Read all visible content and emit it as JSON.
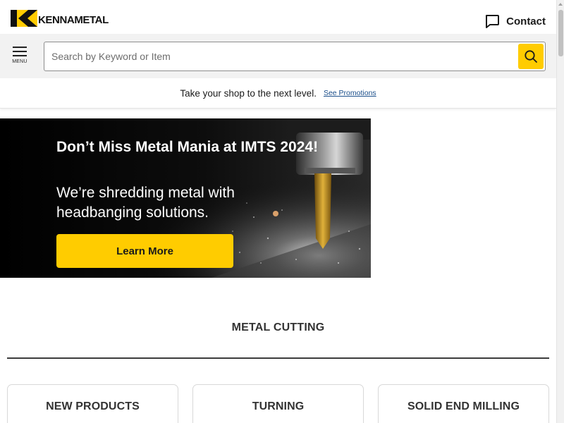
{
  "header": {
    "logo_text": "KENNAMETAL",
    "contact_label": "Contact"
  },
  "icons": {
    "logo": "kennametal-k-logo-icon",
    "contact": "chat-bubble-icon",
    "menu": "hamburger-menu-icon",
    "search": "search-icon"
  },
  "search": {
    "menu_label": "MENU",
    "placeholder": "Search by Keyword or Item",
    "value": ""
  },
  "promo": {
    "text": "Take your shop to the next level.",
    "link": "See Promotions"
  },
  "hero": {
    "title": "Don’t Miss Metal Mania at IMTS 2024!",
    "subtitle": "We’re shredding metal with headbanging solutions.",
    "button": "Learn More"
  },
  "section": {
    "title": "METAL CUTTING",
    "cards": [
      {
        "label": "NEW PRODUCTS"
      },
      {
        "label": "TURNING"
      },
      {
        "label": "SOLID END MILLING"
      }
    ]
  },
  "colors": {
    "accent": "#ffcc00",
    "text": "#1a1a1a",
    "link": "#1a4e8a",
    "search_bar_bg": "#f2f2f2"
  }
}
